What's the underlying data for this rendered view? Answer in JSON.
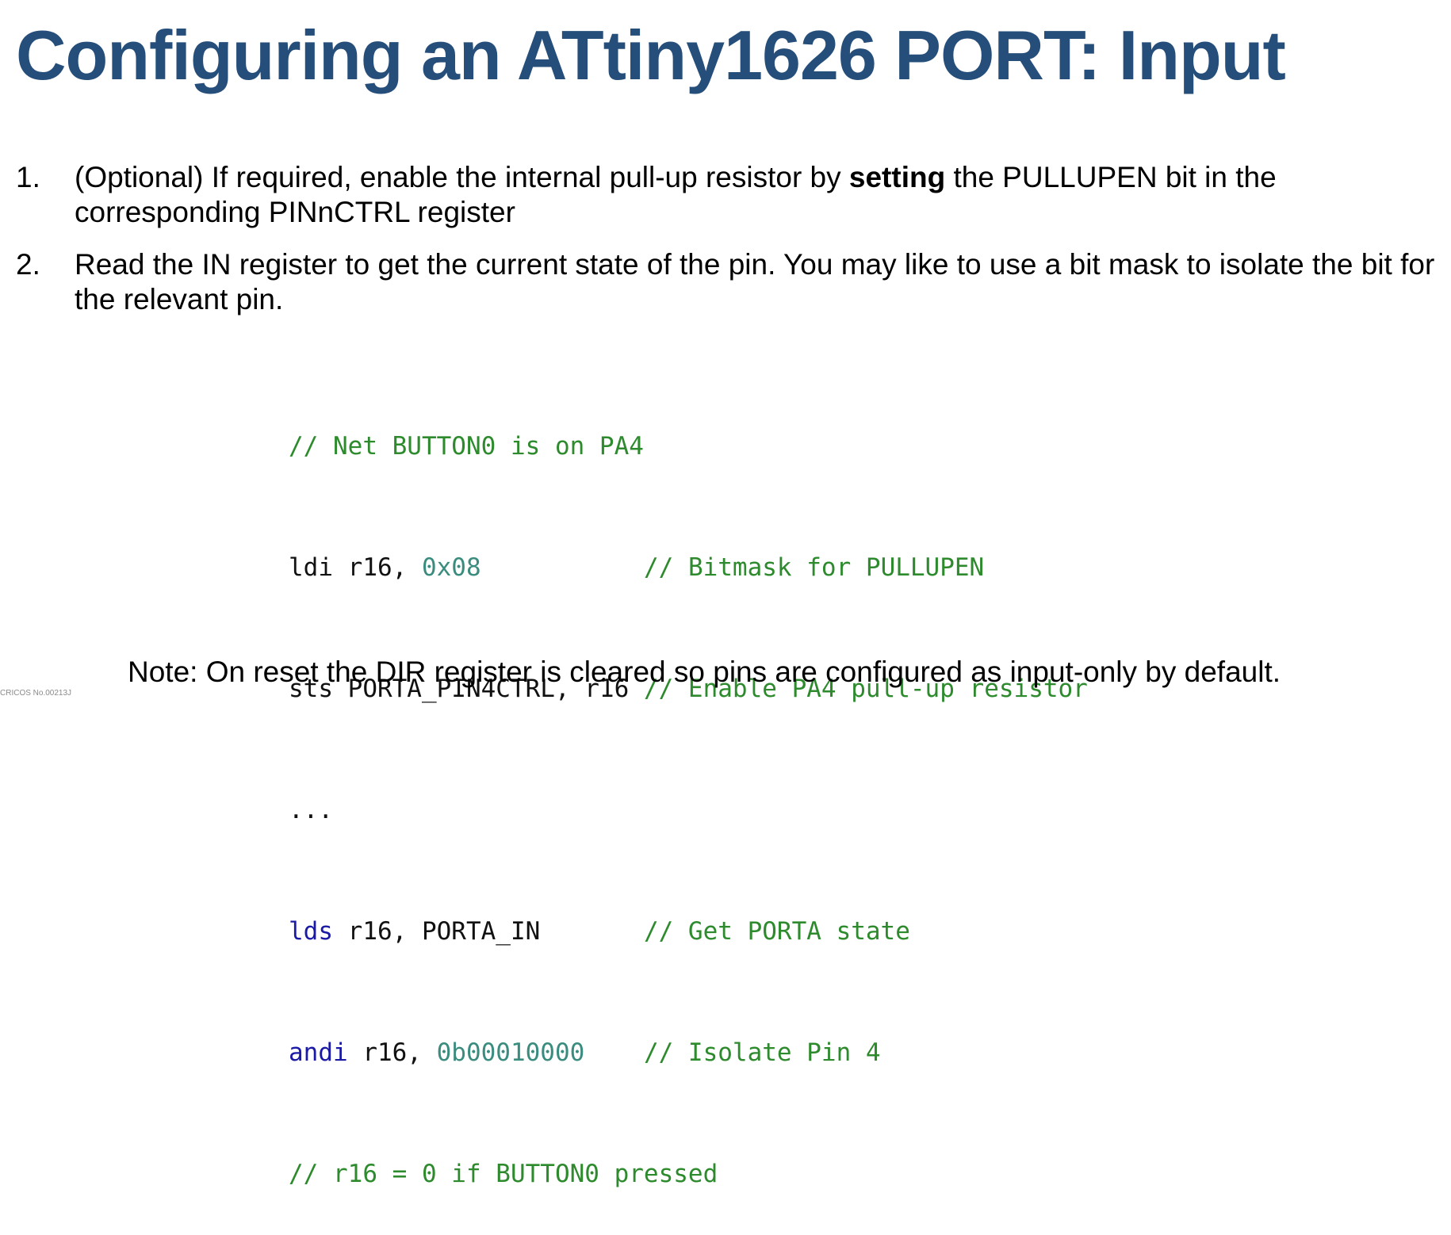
{
  "title": "Configuring an ATtiny1626 PORT: Input",
  "colors": {
    "title": "#264e7a",
    "comment": "#2d8a2d",
    "keyword": "#1a1aa6",
    "number": "#3a8c7e"
  },
  "steps": [
    {
      "number": "1.",
      "text_before": "(Optional) If required, enable the internal pull-up resistor by ",
      "bold": "setting",
      "text_after": " the PULLUPEN bit in the corresponding PINnCTRL register"
    },
    {
      "number": "2.",
      "text": "Read the IN register to get the current state of the pin. You may like to use a bit mask to isolate the bit for the relevant pin."
    }
  ],
  "code": {
    "lines": [
      {
        "comment": "// Net BUTTON0 is on PA4"
      },
      {
        "plain_a": "ldi r16, ",
        "number": "0x08",
        "pad": "           ",
        "comment": "// Bitmask for PULLUPEN"
      },
      {
        "plain_a": "sts PORTA_PIN4CTRL, r16 ",
        "comment": "// Enable PA4 pull-up resistor"
      },
      {
        "plain_a": "..."
      },
      {
        "keyword": "lds",
        "plain_b": " r16, PORTA_IN       ",
        "comment": "// Get PORTA state"
      },
      {
        "keyword": "andi",
        "plain_b": " r16, ",
        "number": "0b00010000",
        "pad": "    ",
        "comment": "// Isolate Pin 4"
      },
      {
        "comment": "// r16 = 0 if BUTTON0 pressed"
      }
    ]
  },
  "note": "Note: On reset the DIR register is cleared so pins are configured as input-only by default.",
  "footer": {
    "cricos": "CRICOS No.00213J"
  }
}
